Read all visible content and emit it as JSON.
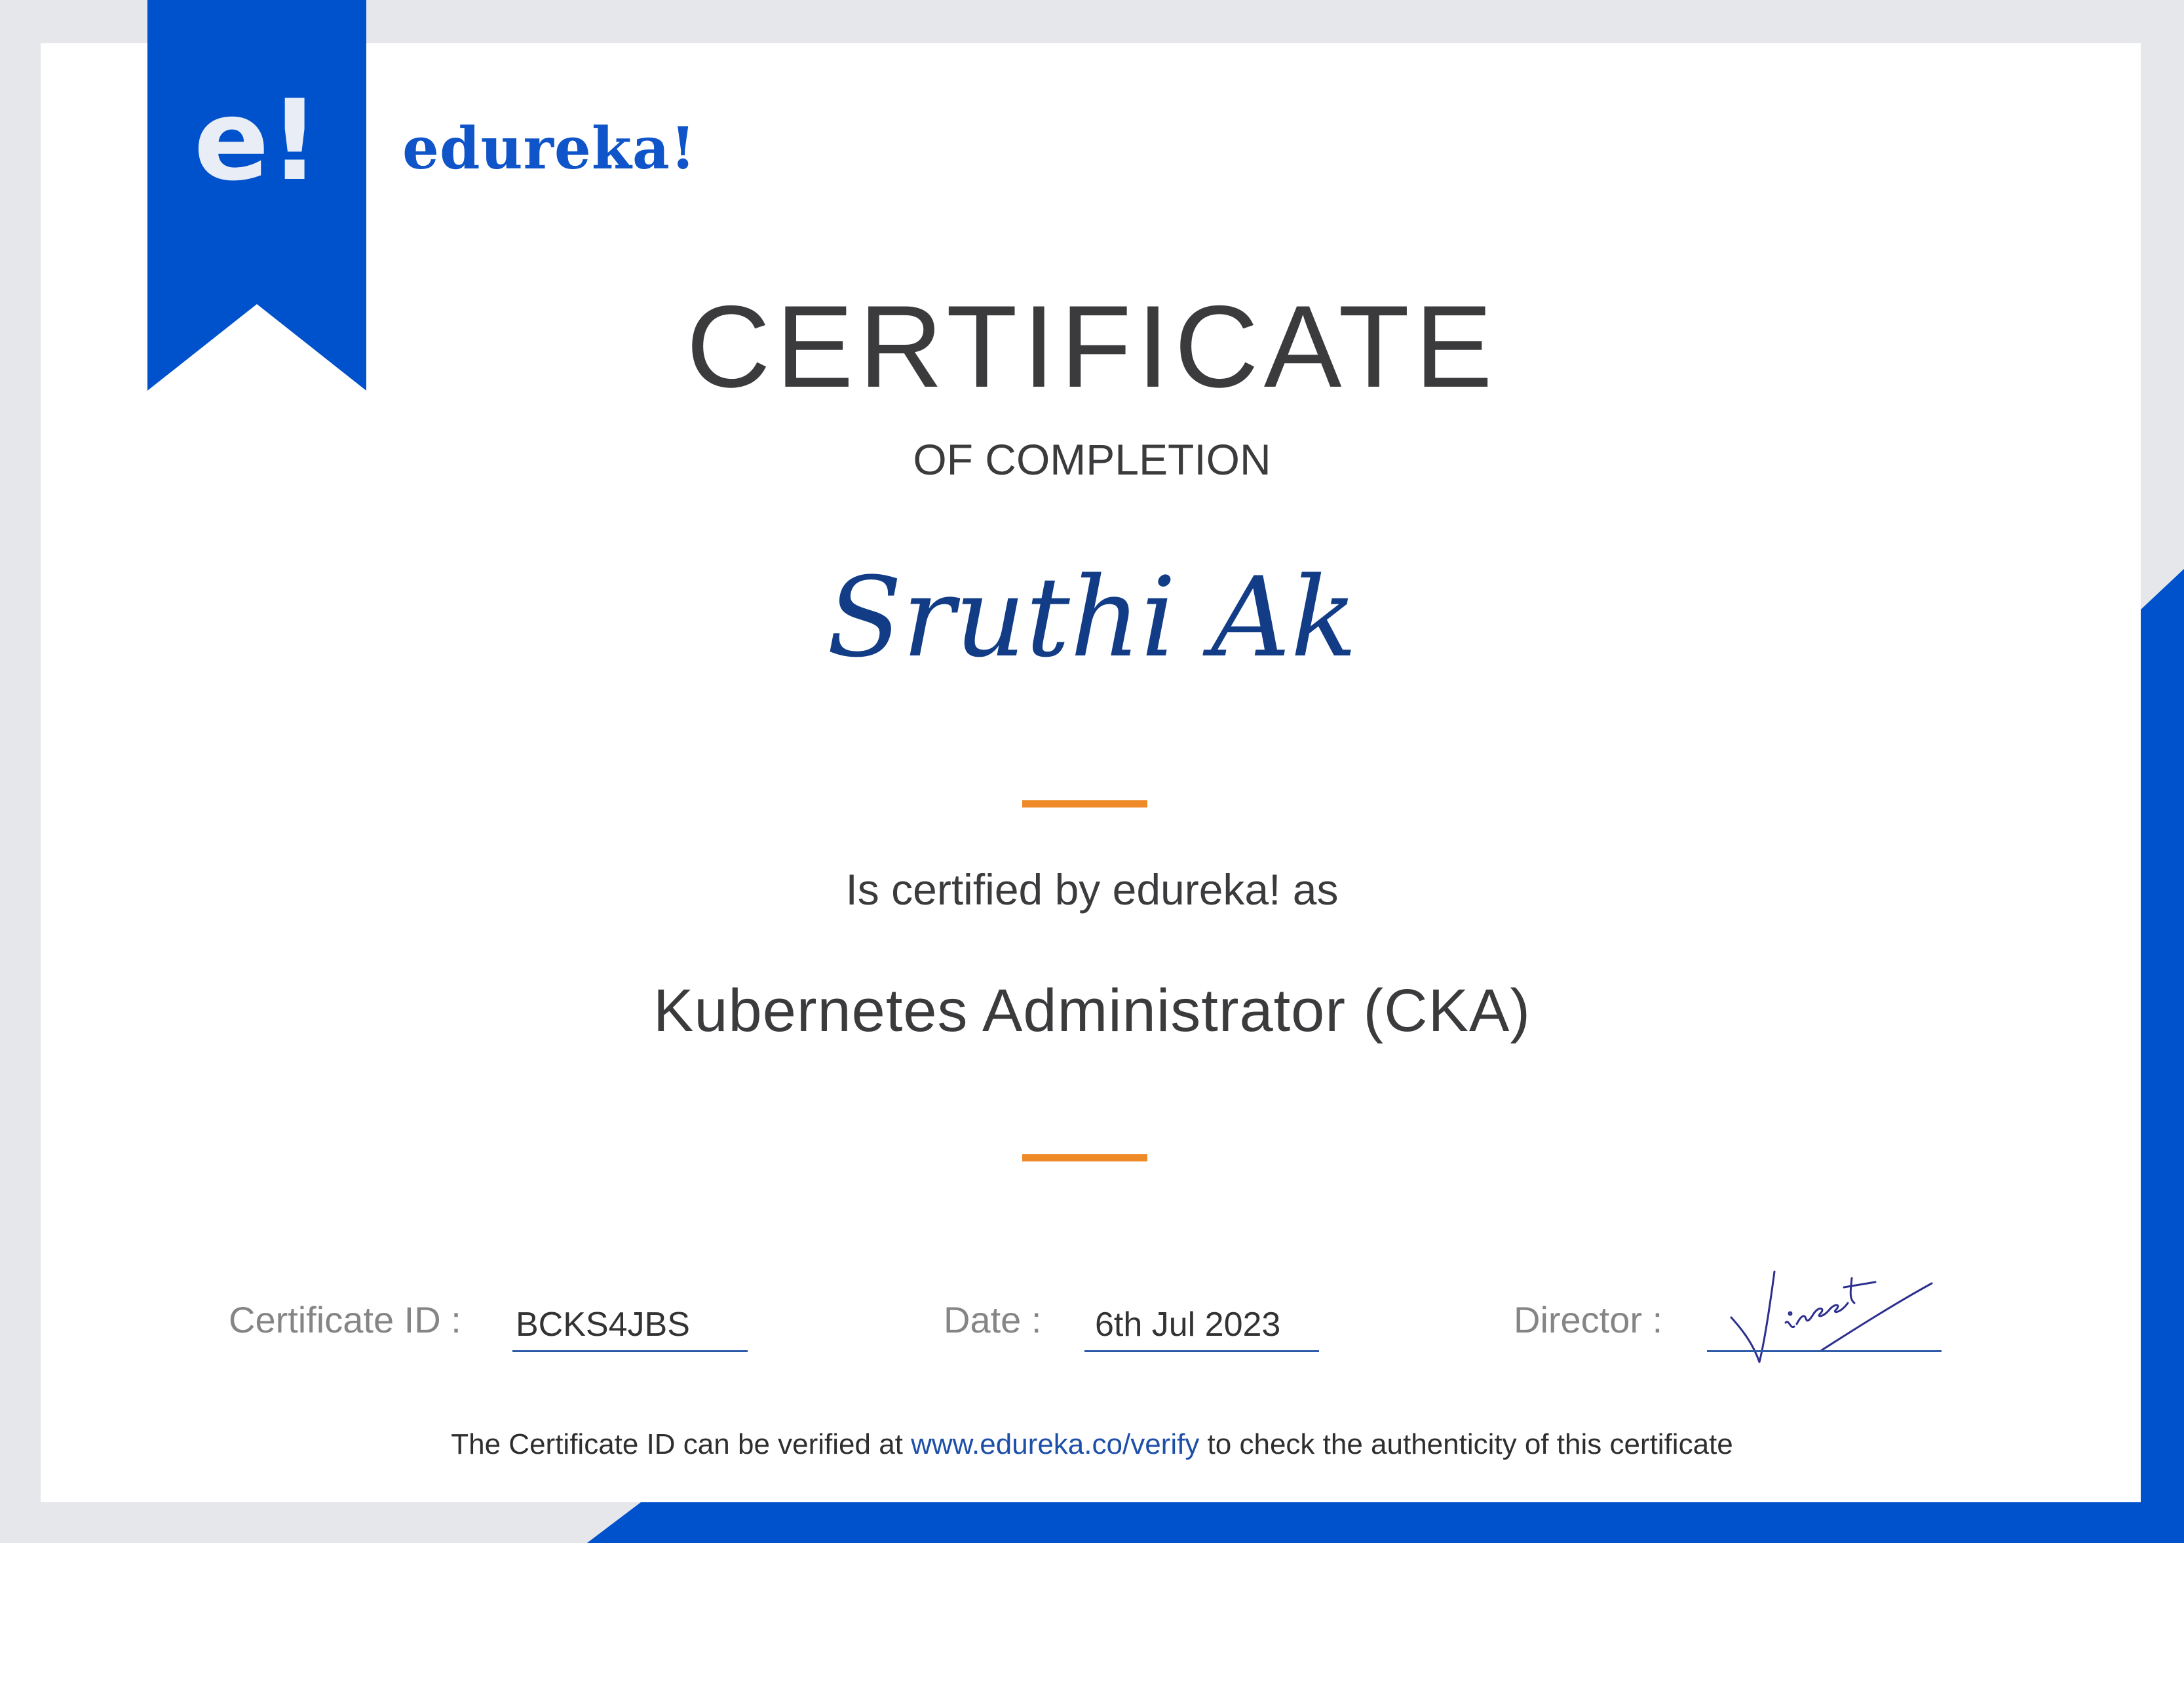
{
  "brand": {
    "ribbon_mark": "e!",
    "logo_text": "edureka!"
  },
  "certificate": {
    "title": "CERTIFICATE",
    "subtitle": "OF COMPLETION",
    "recipient": "Sruthi Ak",
    "certified_by": "Is certified by edureka! as",
    "course": "Kubernetes Administrator (CKA)"
  },
  "details": {
    "id_label": "Certificate ID :",
    "id_value": "BCKS4JBS",
    "date_label": "Date :",
    "date_value": "6th Jul 2023",
    "director_label": "Director :"
  },
  "verify": {
    "before": "The Certificate ID can be verified at",
    "url": "www.edureka.co/verify",
    "after": "to check the authenticity of this certificate"
  },
  "colors": {
    "brand_blue": "#0052cc",
    "accent_orange": "#ee8a27",
    "frame_gray": "#e5e7ea",
    "recipient_blue": "#123d86"
  }
}
